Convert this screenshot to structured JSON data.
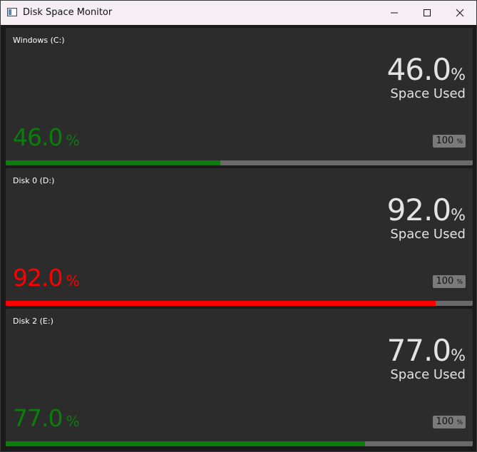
{
  "window": {
    "title": "Disk Space Monitor"
  },
  "colors": {
    "ok": "#0b7d0b",
    "critical": "#ff0000",
    "text": "#e3e3e3",
    "panel_bg": "#2c2c2c",
    "track": "#6a6a6a"
  },
  "icons": {
    "app": "app-icon",
    "minimize": "minimize-icon",
    "maximize": "maximize-icon",
    "close": "close-icon"
  },
  "disks": [
    {
      "name": "Windows (C:)",
      "percent_text": "46.0",
      "unit": "%",
      "label": "Space Used",
      "max_text": "100",
      "max_unit": "%",
      "usage": 0.46,
      "status": "ok"
    },
    {
      "name": "Disk 0 (D:)",
      "percent_text": "92.0",
      "unit": "%",
      "label": "Space Used",
      "max_text": "100",
      "max_unit": "%",
      "usage": 0.92,
      "status": "critical"
    },
    {
      "name": "Disk 2 (E:)",
      "percent_text": "77.0",
      "unit": "%",
      "label": "Space Used",
      "max_text": "100",
      "max_unit": "%",
      "usage": 0.77,
      "status": "ok"
    }
  ]
}
